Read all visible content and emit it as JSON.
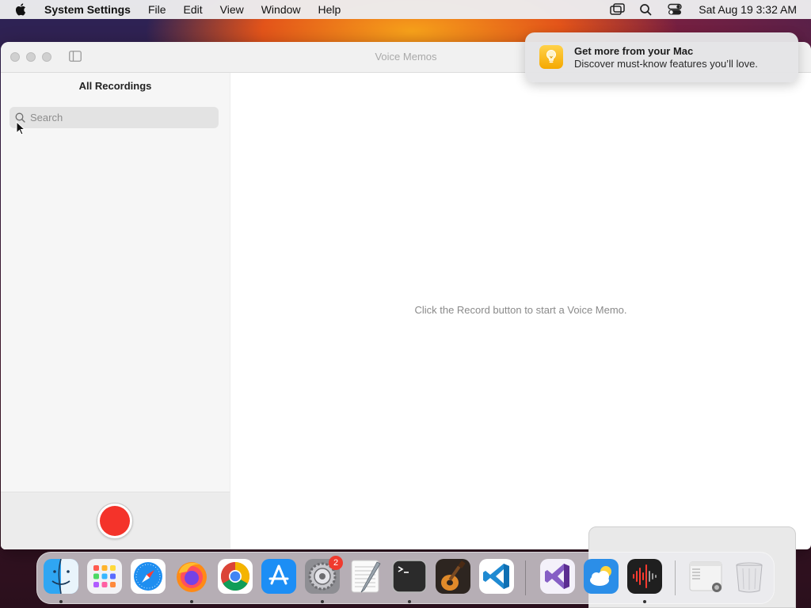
{
  "menubar": {
    "app_name": "System Settings",
    "items": [
      "File",
      "Edit",
      "View",
      "Window",
      "Help"
    ],
    "clock": "Sat Aug 19  3:32 AM"
  },
  "window": {
    "title": "Voice Memos",
    "sidebar_title": "All Recordings",
    "search_placeholder": "Search",
    "empty_message": "Click the Record button to start a Voice Memo.",
    "record_color": "#f4332a"
  },
  "notification": {
    "title": "Get more from your Mac",
    "body": "Discover must-know features you’ll love."
  },
  "dock": {
    "settings_badge": "2",
    "apps": [
      "Finder",
      "Launchpad",
      "Safari",
      "Firefox",
      "Google Chrome",
      "App Store",
      "System Settings",
      "TextEdit",
      "Terminal",
      "GarageBand",
      "Visual Studio Code",
      "Visual Studio",
      "Weather",
      "Voice Memos",
      "Downloads",
      "Trash"
    ]
  }
}
